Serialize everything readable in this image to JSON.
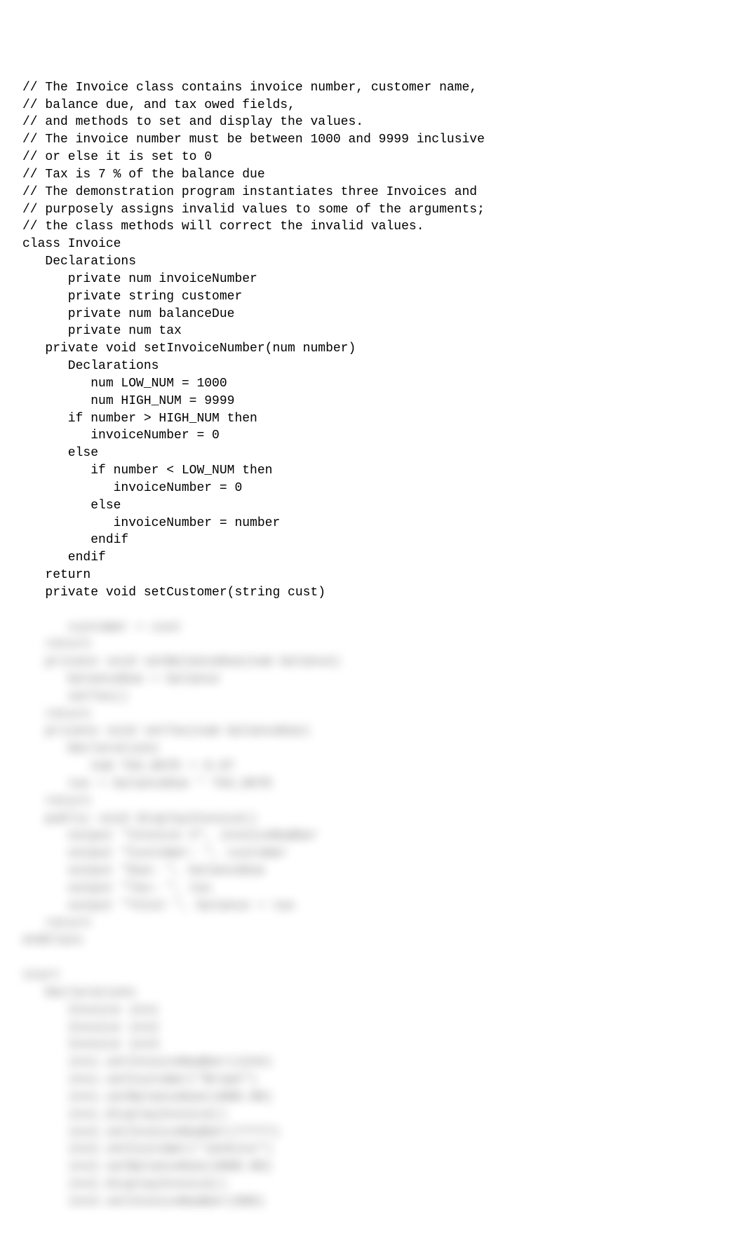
{
  "code": {
    "clear_lines": [
      "// The Invoice class contains invoice number, customer name,",
      "// balance due, and tax owed fields,",
      "// and methods to set and display the values.",
      "// The invoice number must be between 1000 and 9999 inclusive",
      "// or else it is set to 0",
      "// Tax is 7 % of the balance due",
      "// The demonstration program instantiates three Invoices and",
      "// purposely assigns invalid values to some of the arguments;",
      "// the class methods will correct the invalid values.",
      "class Invoice",
      "   Declarations",
      "      private num invoiceNumber",
      "      private string customer",
      "      private num balanceDue",
      "      private num tax",
      "   private void setInvoiceNumber(num number)",
      "      Declarations",
      "         num LOW_NUM = 1000",
      "         num HIGH_NUM = 9999",
      "      if number > HIGH_NUM then",
      "         invoiceNumber = 0",
      "      else",
      "         if number < LOW_NUM then",
      "            invoiceNumber = 0",
      "         else",
      "            invoiceNumber = number",
      "         endif",
      "      endif",
      "   return",
      "   private void setCustomer(string cust)"
    ],
    "blurred_lines": [
      "      customer = cust",
      "   return",
      "   private void setBalanceDue(num balance)",
      "      balanceDue = balance",
      "      setTax()",
      "   return",
      "   private void setTax(num balanceDue)",
      "      Declarations",
      "         num TAX_RATE = 0.07",
      "      tax = balanceDue * TAX_RATE",
      "   return",
      "   public void displayInvoice()",
      "      output \"Invoice #\", invoiceNumber",
      "      output \"Customer: \", customer",
      "      output \"Due: \", balanceDue",
      "      output \"Tax: \", tax",
      "      output \"Total \", balance + tax",
      "   return",
      "endClass",
      "",
      "start",
      "   Declarations",
      "      Invoice inv1",
      "      Invoice inv2",
      "      Invoice inv3",
      "      inv1.setInvoiceNumber(1244)",
      "      inv1.setCustomer(\"Brown\")",
      "      inv1.setBalanceDue(1000.00)",
      "      inv1.displayInvoice()",
      "      inv2.setInvoiceNumber(77777)",
      "      inv2.setCustomer(\"Jenkins\")",
      "      inv2.setBalanceDue(2000.00)",
      "      inv2.displayInvoice()",
      "      inv3.setInvoiceNumber(888)"
    ]
  }
}
